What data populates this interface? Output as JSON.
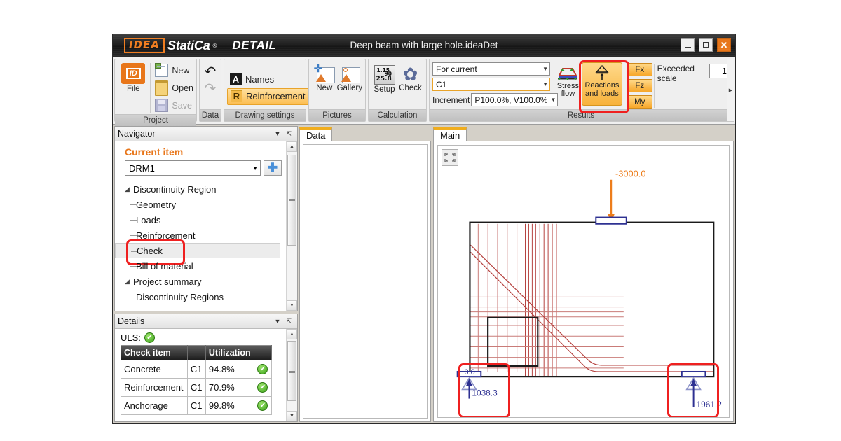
{
  "window": {
    "brand_idea": "IDEA",
    "brand_statica": "StatiCa",
    "brand_reg": "®",
    "module": "DETAIL",
    "document_title": "Deep beam with large hole.ideaDet",
    "minimize": "Minimize",
    "maximize": "Maximize",
    "close": "✕"
  },
  "ribbon": {
    "groups": [
      {
        "name": "Project",
        "title": "Project"
      },
      {
        "name": "Data",
        "title": "Data"
      },
      {
        "name": "Drawing settings",
        "title": "Drawing settings"
      },
      {
        "name": "Pictures",
        "title": "Pictures"
      },
      {
        "name": "Calculation",
        "title": "Calculation"
      },
      {
        "name": "Results",
        "title": "Results"
      }
    ],
    "project": {
      "file": "File",
      "new": "New",
      "open": "Open",
      "save": "Save"
    },
    "data": {
      "undo": "↶",
      "redo": "↷"
    },
    "drawing_settings": {
      "names_glyph": "A",
      "names": "Names",
      "reinforcement_glyph": "R",
      "reinforcement": "Reinforcement"
    },
    "pictures": {
      "new": "New",
      "gallery": "Gallery"
    },
    "calculation": {
      "setup": "Setup",
      "check": "Check",
      "setup_icon_line1": "1.15",
      "setup_icon_line2": "90",
      "setup_icon_line3": "25.8",
      "gear_glyph": "✿"
    },
    "results": {
      "combo_scope": "For current",
      "combo_combination": "C1",
      "increment_label": "Increment",
      "increment_value": "P100.0%, V100.0%",
      "stress_flow_line1": "Stress",
      "stress_flow_line2": "flow",
      "reactions_line1": "Reactions",
      "reactions_line2": "and loads",
      "fx": "Fx",
      "fz": "Fz",
      "my": "My",
      "exceeded_scale_label": "Exceeded scale",
      "exceeded_scale_value": "1"
    }
  },
  "navigator": {
    "title": "Navigator",
    "collapse_glyph": "▼",
    "pin_glyph": "⇱",
    "current_item_label": "Current item",
    "current_item_value": "DRM1",
    "add_glyph": "✚",
    "tree": [
      {
        "label": "Discontinuity Region",
        "type": "node",
        "expander": "◢"
      },
      {
        "label": "Geometry",
        "type": "leaf"
      },
      {
        "label": "Loads",
        "type": "leaf"
      },
      {
        "label": "Reinforcement",
        "type": "leaf"
      },
      {
        "label": "Check",
        "type": "leaf",
        "selected": true,
        "highlighted": true
      },
      {
        "label": "Bill of material",
        "type": "leaf"
      },
      {
        "label": "Project summary",
        "type": "node",
        "expander": "◢"
      },
      {
        "label": "Discontinuity Regions",
        "type": "leaf"
      }
    ]
  },
  "details": {
    "title": "Details",
    "collapse_glyph": "▼",
    "pin_glyph": "⇱",
    "uls_label": "ULS:",
    "uls_status": "✔",
    "columns": [
      "Check item",
      "",
      "Utilization",
      ""
    ],
    "rows": [
      {
        "item": "Concrete",
        "combination": "C1",
        "utilization": "94.8%",
        "status": "✔"
      },
      {
        "item": "Reinforcement",
        "combination": "C1",
        "utilization": "70.9%",
        "status": "✔"
      },
      {
        "item": "Anchorage",
        "combination": "C1",
        "utilization": "99.8%",
        "status": "✔"
      }
    ]
  },
  "tabs": {
    "data_tab": "Data",
    "main_tab": "Main"
  },
  "canvas": {
    "fit_icon": "zoom-to-fit",
    "load_value": "-3000.0",
    "left_support_horizontal": "0.0",
    "left_support_vertical": "1038.3",
    "right_support_vertical": "1961.2",
    "colors": {
      "load_arrow": "#ED7D1B",
      "reaction_arrow": "#2E3192",
      "reinforcement": "#B5413E",
      "outline": "#1a1a1a",
      "highlight_ring": "#EF2020"
    }
  }
}
